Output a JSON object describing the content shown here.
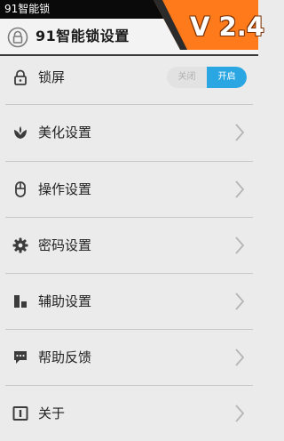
{
  "status_bar": {
    "app_name": "91智能锁"
  },
  "header": {
    "title": "91智能锁设置",
    "version": "V 2.4"
  },
  "lock_screen": {
    "label": "锁屏",
    "toggle_off": "关闭",
    "toggle_on": "开启",
    "state": "开启"
  },
  "menu": {
    "items": [
      {
        "label": "美化设置",
        "icon": "flower-icon"
      },
      {
        "label": "操作设置",
        "icon": "mouse-icon"
      },
      {
        "label": "密码设置",
        "icon": "gear-icon"
      },
      {
        "label": "辅助设置",
        "icon": "blocks-icon"
      },
      {
        "label": "帮助反馈",
        "icon": "chat-bubble-icon"
      },
      {
        "label": "关于",
        "icon": "info-icon"
      }
    ]
  },
  "colors": {
    "accent": "#2aa7e3",
    "ribbon": "#ff7a1a",
    "background": "#ebebeb"
  }
}
